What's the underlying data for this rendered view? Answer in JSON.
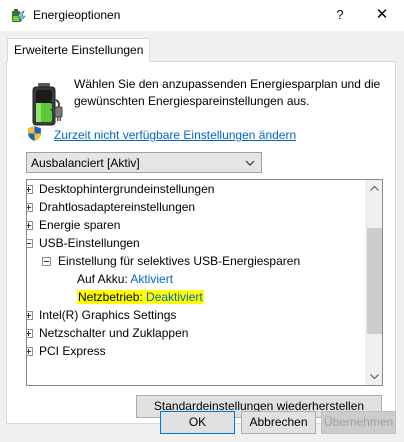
{
  "window": {
    "title": "Energieoptionen",
    "help_glyph": "?",
    "close_glyph": "✕"
  },
  "tab": {
    "label": "Erweiterte Einstellungen"
  },
  "description": "Wählen Sie den anzupassenden Energiesparplan und die gewünschten Energiespareinstellungen aus.",
  "link": {
    "label": "Zurzeit nicht verfügbare Einstellungen ändern"
  },
  "plan_select": {
    "value": "Ausbalanciert [Aktiv]"
  },
  "tree": {
    "items": [
      {
        "label": "Desktophintergrundeinstellungen",
        "expander": "plus"
      },
      {
        "label": "Drahtlosadaptereinstellungen",
        "expander": "plus"
      },
      {
        "label": "Energie sparen",
        "expander": "plus"
      },
      {
        "label": "USB-Einstellungen",
        "expander": "minus"
      },
      {
        "label": "Einstellung für selektives USB-Energiesparen",
        "expander": "minus"
      },
      {
        "label": "Auf Akku:",
        "value": "Aktiviert"
      },
      {
        "label": "Netzbetrieb:",
        "value": "Deaktiviert"
      },
      {
        "label": "Intel(R) Graphics Settings",
        "expander": "plus"
      },
      {
        "label": "Netzschalter und Zuklappen",
        "expander": "plus"
      },
      {
        "label": "PCI Express",
        "expander": "plus"
      }
    ]
  },
  "buttons": {
    "restore": "Standardeinstellungen wiederherstellen",
    "ok": "OK",
    "cancel": "Abbrechen",
    "apply": "Übernehmen"
  },
  "icons": {
    "app": "power-options-icon",
    "battery": "battery-icon",
    "shield": "uac-shield-icon"
  },
  "colors": {
    "link": "#0066cc",
    "highlight": "#ffff00",
    "ok_border": "#0078d7"
  }
}
